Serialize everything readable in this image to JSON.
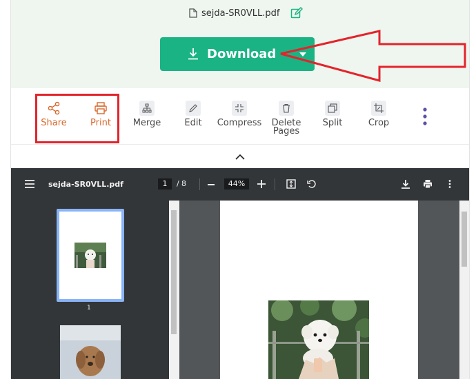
{
  "file": {
    "name": "sejda-SR0VLL.pdf",
    "edit_icon": "edit-icon"
  },
  "download": {
    "label": "Download",
    "color": "#1ab384"
  },
  "tools": [
    {
      "label": "Share",
      "icon": "share-icon"
    },
    {
      "label": "Print",
      "icon": "print-icon"
    },
    {
      "label": "Merge",
      "icon": "merge-icon"
    },
    {
      "label": "Edit",
      "icon": "pencil-icon"
    },
    {
      "label": "Compress",
      "icon": "compress-icon"
    },
    {
      "label": "Delete Pages",
      "icon": "trash-icon"
    },
    {
      "label": "Split",
      "icon": "split-icon"
    },
    {
      "label": "Crop",
      "icon": "crop-icon"
    }
  ],
  "viewer": {
    "title": "sejda-SR0VLL.pdf",
    "current_page": "1",
    "page_separator": "/",
    "total_pages": "8",
    "zoom": "44%",
    "thumbnail_label": "1"
  },
  "colors": {
    "accent": "#1ab384",
    "highlight": "#e4232b",
    "tool_orange": "#d8682c",
    "viewer_bar": "#323639"
  }
}
